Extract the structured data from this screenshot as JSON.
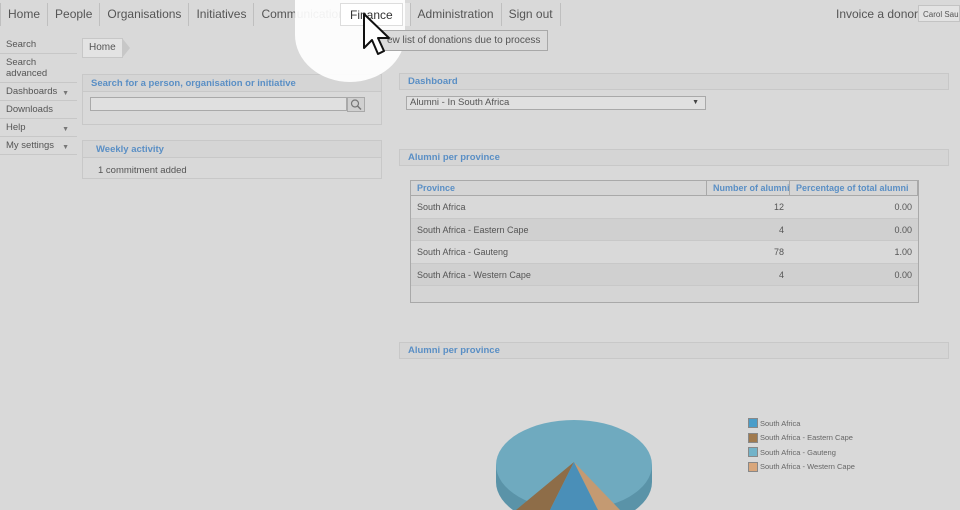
{
  "topnav": {
    "items": [
      "Home",
      "People",
      "Organisations",
      "Initiatives",
      "Communication",
      "Finance",
      "Administration",
      "Sign out"
    ],
    "active": "Finance"
  },
  "invoice_label": "Invoice a donor",
  "user_chip": "Carol Saur",
  "tooltip": "ew list of donations due to process",
  "sidebar": {
    "items": [
      {
        "label": "Search",
        "arrow": ""
      },
      {
        "label": "Search advanced",
        "arrow": ""
      },
      {
        "label": "Dashboards",
        "arrow": "▼"
      },
      {
        "label": "Downloads",
        "arrow": ""
      },
      {
        "label": "Help",
        "arrow": "▼"
      },
      {
        "label": "My settings",
        "arrow": "▼"
      }
    ]
  },
  "breadcrumb": "Home",
  "search_panel": {
    "title": "Search for a person, organisation or initiative",
    "value": ""
  },
  "activity_panel": {
    "title": "Weekly activity",
    "text": "1 commitment added"
  },
  "dashboard": {
    "title": "Dashboard",
    "selected": "Alumni - In South Africa"
  },
  "alumni_table": {
    "title": "Alumni per province",
    "columns": [
      "Province",
      "Number of alumni",
      "Percentage of total alumni"
    ],
    "rows": [
      [
        "South Africa",
        "12",
        "0.00"
      ],
      [
        "South Africa - Eastern Cape",
        "4",
        "0.00"
      ],
      [
        "South Africa - Gauteng",
        "78",
        "1.00"
      ],
      [
        "South Africa - Western Cape",
        "4",
        "0.00"
      ]
    ]
  },
  "alumni_chart": {
    "title": "Alumni per province",
    "legend": [
      {
        "label": "South Africa",
        "color": "#4a9dc9"
      },
      {
        "label": "South Africa - Eastern Cape",
        "color": "#a07a4e"
      },
      {
        "label": "South Africa - Gauteng",
        "color": "#72b3c9"
      },
      {
        "label": "South Africa - Western Cape",
        "color": "#d9a77c"
      }
    ]
  }
}
